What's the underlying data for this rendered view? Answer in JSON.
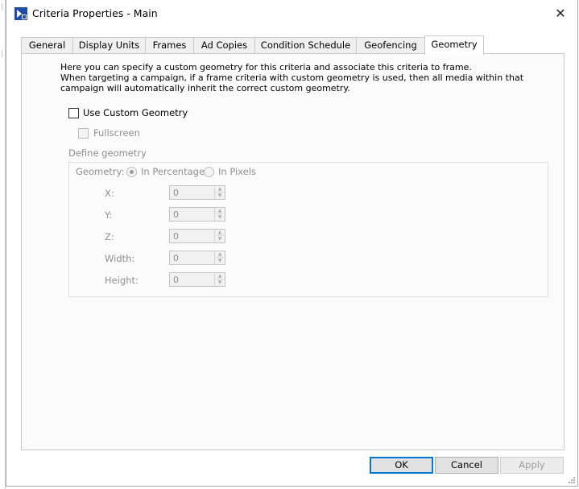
{
  "window": {
    "title": "Criteria Properties - Main",
    "close_symbol": "✕"
  },
  "tabs": [
    {
      "label": "General"
    },
    {
      "label": "Display Units"
    },
    {
      "label": "Frames"
    },
    {
      "label": "Ad Copies"
    },
    {
      "label": "Condition Schedule"
    },
    {
      "label": "Geofencing"
    },
    {
      "label": "Geometry",
      "active": true
    }
  ],
  "geometry_tab": {
    "description_line1": "Here you can specify a custom geometry for this criteria and associate this criteria to frame.",
    "description_line2": "When targeting a campaign, if a frame criteria with custom geometry is used, then all media within that campaign will automatically inherit the correct custom geometry.",
    "use_custom_geometry": {
      "label": "Use Custom Geometry",
      "checked": false
    },
    "fullscreen": {
      "label": "Fullscreen",
      "checked": false,
      "enabled": false
    },
    "define_geometry": {
      "label": "Define geometry",
      "geometry_label": "Geometry:",
      "in_percentage": {
        "label": "In Percentage",
        "selected": true
      },
      "in_pixels": {
        "label": "In Pixels",
        "selected": false
      },
      "fields": [
        {
          "label": "X:",
          "value": "0"
        },
        {
          "label": "Y:",
          "value": "0"
        },
        {
          "label": "Z:",
          "value": "0"
        },
        {
          "label": "Width:",
          "value": "0"
        },
        {
          "label": "Height:",
          "value": "0"
        }
      ]
    }
  },
  "buttons": {
    "ok": "OK",
    "cancel": "Cancel",
    "apply": "Apply"
  },
  "colors": {
    "accent": "#0078d7",
    "icon_blue": "#1e4aa8"
  }
}
